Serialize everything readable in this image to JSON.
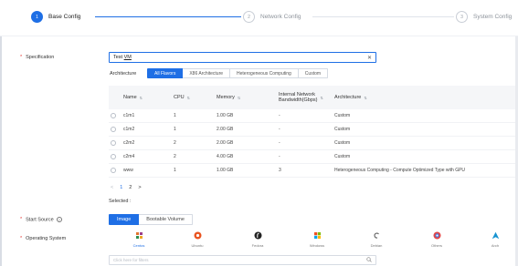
{
  "stepper": {
    "steps": [
      {
        "num": "1",
        "label": "Base Config"
      },
      {
        "num": "2",
        "label": "Network Config"
      },
      {
        "num": "3",
        "label": "System Config"
      }
    ]
  },
  "specification": {
    "label": "Specification",
    "input_value": "Test VM",
    "input_value_prefix": "Test ",
    "input_value_suffix": "VM",
    "clear_icon": "close-icon"
  },
  "architecture": {
    "label": "Architecture",
    "filters": [
      "All Flavors",
      "X86 Architecture",
      "Heterogeneous Computing",
      "Custom"
    ],
    "selected": "All Flavors"
  },
  "table": {
    "headers": [
      "Name",
      "CPU",
      "Memory",
      "Internal Network Bandwidth(Gbps)",
      "Architecture"
    ],
    "header_bw_line1": "Internal Network",
    "header_bw_line2": "Bandwidth(Gbps)",
    "rows": [
      {
        "name": "c1m1",
        "cpu": "1",
        "memory": "1.00 GB",
        "bandwidth": "-",
        "architecture": "Custom"
      },
      {
        "name": "c1m2",
        "cpu": "1",
        "memory": "2.00 GB",
        "bandwidth": "-",
        "architecture": "Custom"
      },
      {
        "name": "c2m2",
        "cpu": "2",
        "memory": "2.00 GB",
        "bandwidth": "-",
        "architecture": "Custom"
      },
      {
        "name": "c2m4",
        "cpu": "2",
        "memory": "4.00 GB",
        "bandwidth": "-",
        "architecture": "Custom"
      },
      {
        "name": "www",
        "cpu": "1",
        "memory": "1.00 GB",
        "bandwidth": "3",
        "architecture": "Heterogeneous Computing - Compute Optimized Type with GPU"
      }
    ]
  },
  "pagination": {
    "prev": "<",
    "pages": [
      "1",
      "2"
    ],
    "current": "1",
    "next": ">"
  },
  "selected_label": "Selected :",
  "start_source": {
    "label": "Start Source",
    "options": [
      "Image",
      "Bootable Volume"
    ],
    "selected": "Image"
  },
  "operating_system": {
    "label": "Operating System",
    "options": [
      {
        "name": "Centos",
        "icon": "centos-icon",
        "color": "#e2742f"
      },
      {
        "name": "Ubuntu",
        "icon": "ubuntu-icon",
        "color": "#e95420"
      },
      {
        "name": "Fedora",
        "icon": "fedora-icon",
        "color": "#222222"
      },
      {
        "name": "Windows",
        "icon": "windows-icon",
        "color": "#3b8cd6"
      },
      {
        "name": "Debian",
        "icon": "debian-icon",
        "color": "#555555"
      },
      {
        "name": "Others",
        "icon": "others-icon",
        "color": "#e24545"
      },
      {
        "name": "Arch",
        "icon": "arch-icon",
        "color": "#1793d1"
      }
    ],
    "selected": "Centos"
  },
  "search": {
    "placeholder": "Click here for filters"
  },
  "colors": {
    "primary": "#1f6fe5",
    "required": "#e53935"
  }
}
